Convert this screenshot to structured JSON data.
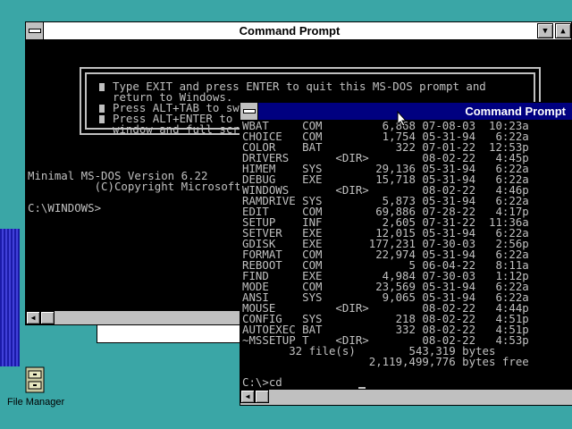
{
  "desktop": {
    "icon_label": "File Manager"
  },
  "back_window": {
    "title": "Command Prompt",
    "message_lines": [
      "Type EXIT and press ENTER to quit this MS-DOS prompt and",
      "return to Windows.",
      "Press ALT+TAB to switch to Windows or another application.",
      "Press ALT+ENTER to switch this MS-DOS Prompt between a",
      "window and full screen."
    ],
    "console_lines": [
      "Minimal MS-DOS Version 6.22",
      "          (C)Copyright Microsoft Corp 1981-1994.",
      "",
      "C:\\WINDOWS>"
    ]
  },
  "front_window": {
    "title": "Command Prompt",
    "rows": [
      "WBAT     COM         6,868 07-08-03  10:23a",
      "CHOICE   COM         1,754 05-31-94   6:22a",
      "COLOR    BAT           322 07-01-22  12:53p",
      "DRIVERS       <DIR>        08-02-22   4:45p",
      "HIMEM    SYS        29,136 05-31-94   6:22a",
      "DEBUG    EXE        15,718 05-31-94   6:22a",
      "WINDOWS       <DIR>        08-02-22   4:46p",
      "RAMDRIVE SYS         5,873 05-31-94   6:22a",
      "EDIT     COM        69,886 07-28-22   4:17p",
      "SETUP    INF         2,605 07-31-22  11:36a",
      "SETVER   EXE        12,015 05-31-94   6:22a",
      "GDISK    EXE       177,231 07-30-03   2:56p",
      "FORMAT   COM        22,974 05-31-94   6:22a",
      "REBOOT   COM             5 06-04-22   8:11a",
      "FIND     EXE         4,984 07-30-03   1:12p",
      "MODE     COM        23,569 05-31-94   6:22a",
      "ANSI     SYS         9,065 05-31-94   6:22a",
      "MOUSE         <DIR>        08-02-22   4:44p",
      "CONFIG   SYS           218 08-02-22   4:51p",
      "AUTOEXEC BAT           332 08-02-22   4:51p",
      "~MSSETUP T    <DIR>        08-02-22   4:53p",
      "       32 file(s)        543,319 bytes",
      "                   2,119,499,776 bytes free"
    ],
    "prompt": "C:\\>cd"
  }
}
